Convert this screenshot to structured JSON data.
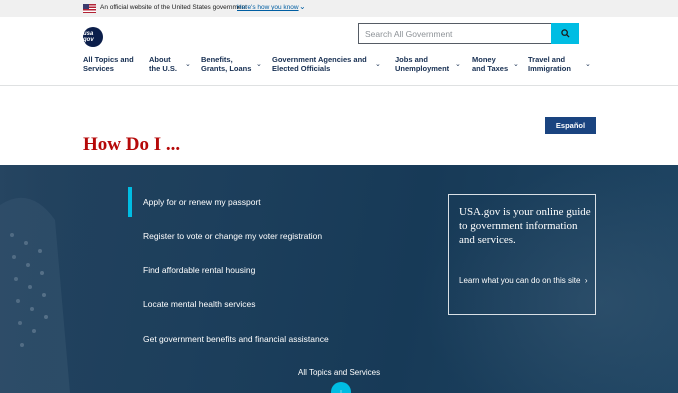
{
  "banner": {
    "text": "An official website of the United States government",
    "link": "Here's how you know",
    "chevron_icon": "chevron-down-icon"
  },
  "header": {
    "logo": "usa gov",
    "search": {
      "placeholder": "Search All Government",
      "icon": "search-icon"
    }
  },
  "nav": {
    "items": [
      {
        "line1": "All Topics and",
        "line2": "Services",
        "has_chevron": false
      },
      {
        "line1": "About",
        "line2": "the U.S.",
        "has_chevron": true
      },
      {
        "line1": "Benefits,",
        "line2": "Grants, Loans",
        "has_chevron": true
      },
      {
        "line1": "Government Agencies and",
        "line2": "Elected Officials",
        "has_chevron": true
      },
      {
        "line1": "Jobs and",
        "line2": "Unemployment",
        "has_chevron": true
      },
      {
        "line1": "Money",
        "line2": "and Taxes",
        "has_chevron": true
      },
      {
        "line1": "Travel and",
        "line2": "Immigration",
        "has_chevron": true
      }
    ]
  },
  "language_button": "Español",
  "page_title": "How Do I ...",
  "hero": {
    "links": [
      "Apply for or renew my passport",
      "Register to vote or change my voter registration",
      "Find affordable rental housing",
      "Locate mental health services",
      "Get government benefits and financial assistance"
    ],
    "info_box": {
      "heading": "USA.gov is your online guide to government information and services.",
      "link": "Learn what you can do on this site"
    },
    "all_topics": "All Topics and Services"
  },
  "colors": {
    "title_red": "#b50909",
    "nav_navy": "#162e51",
    "accent_cyan": "#00bde3",
    "hero_bg": "#1d3f5c"
  }
}
